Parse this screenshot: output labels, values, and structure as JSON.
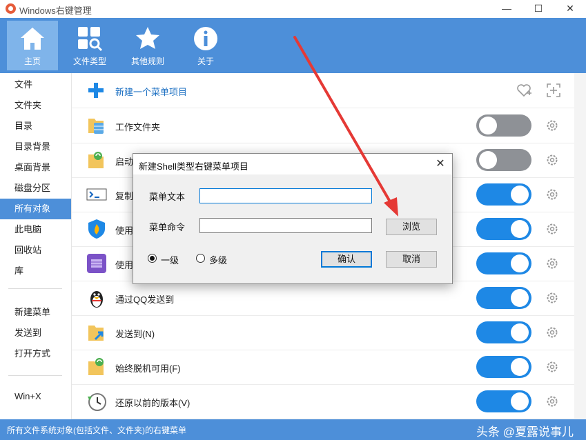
{
  "window": {
    "title": "Windows右键管理",
    "minimize": "—",
    "maximize": "☐",
    "close": "✕"
  },
  "toolbar": {
    "items": [
      {
        "label": "主页",
        "icon": "home-icon",
        "active": true
      },
      {
        "label": "文件类型",
        "icon": "file-type-icon",
        "active": false
      },
      {
        "label": "其他规则",
        "icon": "star-icon",
        "active": false
      },
      {
        "label": "关于",
        "icon": "info-icon",
        "active": false
      }
    ]
  },
  "sidebar": {
    "items": [
      "文件",
      "文件夹",
      "目录",
      "目录背景",
      "桌面背景",
      "磁盘分区",
      "所有对象",
      "此电脑",
      "回收站",
      "库"
    ],
    "active": "所有对象",
    "group2": [
      "新建菜单",
      "发送到",
      "打开方式"
    ],
    "group3": [
      "Win+X"
    ]
  },
  "list": {
    "new_item_label": "新建一个菜单项目",
    "rows": [
      {
        "label": "工作文件夹",
        "enabled": false,
        "icon": "folder-db-icon"
      },
      {
        "label": "启动",
        "enabled": false,
        "icon": "folder-sync-icon"
      },
      {
        "label": "复制",
        "enabled": true,
        "icon": "powershell-icon"
      },
      {
        "label": "使用",
        "enabled": true,
        "icon": "shield-fire-icon"
      },
      {
        "label": "使用",
        "enabled": true,
        "icon": "app-purple-icon"
      },
      {
        "label": "通过QQ发送到",
        "enabled": true,
        "icon": "qq-penguin-icon"
      },
      {
        "label": "发送到(N)",
        "enabled": true,
        "icon": "folder-send-icon"
      },
      {
        "label": "始终脱机可用(F)",
        "enabled": true,
        "icon": "folder-offline-icon"
      },
      {
        "label": "还原以前的版本(V)",
        "enabled": true,
        "icon": "clock-restore-icon"
      }
    ]
  },
  "status": {
    "text": "所有文件系统对象(包括文件、文件夹)的右键菜单",
    "watermark": "头条 @夏露说事儿"
  },
  "dialog": {
    "title": "新建Shell类型右键菜单项目",
    "text_label": "菜单文本",
    "text_value": "",
    "command_label": "菜单命令",
    "command_value": "",
    "browse": "浏览",
    "level_single": "一级",
    "level_multi": "多级",
    "selected_level": "一级",
    "ok": "确认",
    "cancel": "取消"
  },
  "colors": {
    "accent": "#4d8fd9",
    "toggle_on": "#1e88e5",
    "toggle_off": "#8e9196",
    "annotation_arrow": "#e53935"
  }
}
